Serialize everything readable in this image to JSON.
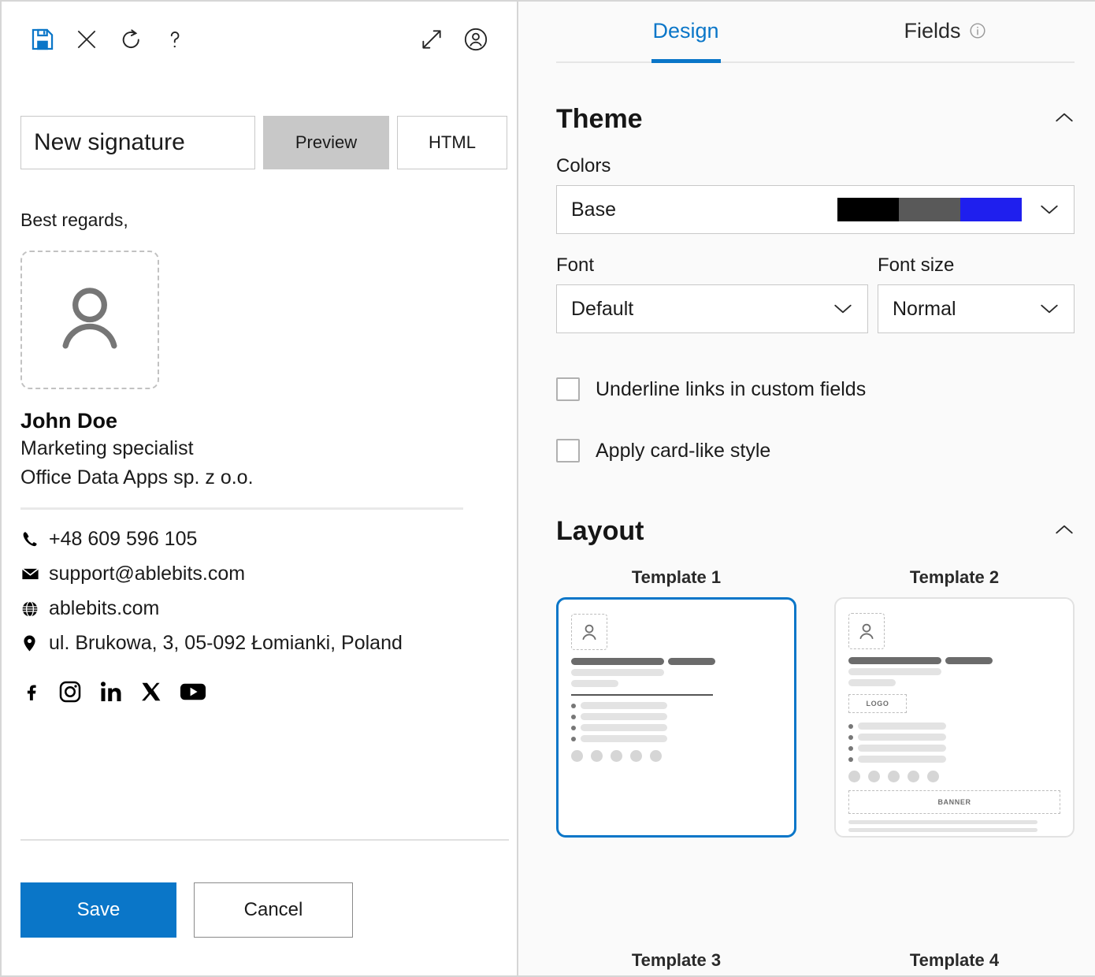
{
  "toolbar": {
    "icons": [
      {
        "name": "save-icon",
        "title": "Save"
      },
      {
        "name": "close-icon",
        "title": "Close"
      },
      {
        "name": "reset-icon",
        "title": "Reset"
      },
      {
        "name": "help-icon",
        "title": "Help"
      },
      {
        "name": "expand-icon",
        "title": "Expand"
      },
      {
        "name": "account-icon",
        "title": "Account"
      }
    ],
    "save_accent": "#0a76c8"
  },
  "editor": {
    "signature_name": "New signature",
    "signature_name_placeholder": "New signature",
    "preview_label": "Preview",
    "html_label": "HTML",
    "active_mode": "Preview"
  },
  "signature": {
    "greeting": "Best regards,",
    "avatar_placeholder_icon": "person-icon",
    "name": "John Doe",
    "job_title": "Marketing specialist",
    "company": "Office Data Apps sp. z o.o.",
    "contacts": [
      {
        "icon": "phone-icon",
        "value": "+48 609 596 105"
      },
      {
        "icon": "email-icon",
        "value": "support@ablebits.com"
      },
      {
        "icon": "globe-icon",
        "value": "ablebits.com"
      },
      {
        "icon": "location-pin-icon",
        "value": "ul. Brukowa, 3, 05-092 Łomianki, Poland"
      }
    ],
    "social": [
      {
        "icon": "facebook-icon",
        "name": "Facebook"
      },
      {
        "icon": "instagram-icon",
        "name": "Instagram"
      },
      {
        "icon": "linkedin-icon",
        "name": "LinkedIn"
      },
      {
        "icon": "x-twitter-icon",
        "name": "X"
      },
      {
        "icon": "youtube-icon",
        "name": "YouTube"
      }
    ]
  },
  "footer": {
    "save_label": "Save",
    "cancel_label": "Cancel",
    "save_bg": "#0a76c8"
  },
  "panel": {
    "tabs": [
      {
        "label": "Design",
        "active": true
      },
      {
        "label": "Fields",
        "active": false,
        "has_info": true
      }
    ],
    "theme": {
      "title": "Theme",
      "colors_label": "Colors",
      "colors_value": "Base",
      "swatches": [
        "#000000",
        "#595959",
        "#1f1fee"
      ],
      "font_label": "Font",
      "font_value": "Default",
      "font_size_label": "Font size",
      "font_size_value": "Normal",
      "checkboxes": [
        {
          "label": "Underline links in custom fields",
          "checked": false
        },
        {
          "label": "Apply card-like style",
          "checked": false
        }
      ]
    },
    "layout": {
      "title": "Layout",
      "templates": [
        {
          "label": "Template 1",
          "selected": true,
          "has_logo": false,
          "has_banner": false
        },
        {
          "label": "Template 2",
          "selected": false,
          "has_logo": true,
          "has_banner": true
        },
        {
          "label": "Template 3",
          "selected": false,
          "has_logo": false,
          "has_banner": false
        },
        {
          "label": "Template 4",
          "selected": false,
          "has_logo": false,
          "has_banner": false
        }
      ],
      "logo_label": "LOGO",
      "banner_label": "BANNER",
      "selected_accent": "#0a76c8"
    }
  }
}
